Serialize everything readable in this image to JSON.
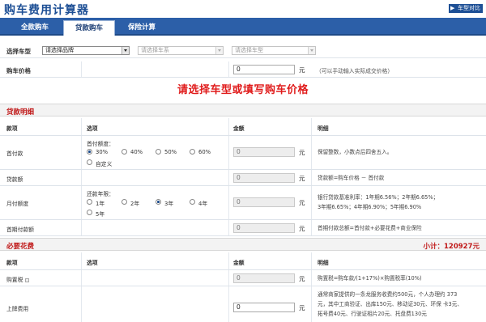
{
  "header": {
    "title": "购车费用计算器",
    "compare_link": "车型对比",
    "compare_arrow": "▶"
  },
  "tabs": [
    {
      "label": "全款购车",
      "active": false
    },
    {
      "label": "贷款购车",
      "active": true
    },
    {
      "label": "保险计算",
      "active": false
    }
  ],
  "car_select": {
    "label": "选择车型",
    "brand_value": "请选择品牌",
    "series_value": "请选择车系",
    "model_value": "请选择车型"
  },
  "price": {
    "label": "购车价格",
    "value": "0",
    "unit": "元",
    "hint": "（可以手动输入实际成交价格）"
  },
  "prompt": "请选择车型或填写购车价格",
  "loan": {
    "section_title": "贷款明细",
    "headers": {
      "item": "款项",
      "option": "选项",
      "amount": "金额",
      "detail": "明细"
    },
    "down_payment": {
      "label": "首付款",
      "ratio_label": "首付额度：",
      "options": [
        "30%",
        "40%",
        "50%",
        "60%",
        "自定义"
      ],
      "selected": "30%",
      "value": "0",
      "unit": "元",
      "detail": "保留整数，小数点后四舍五入。"
    },
    "loan_amount": {
      "label": "贷款额",
      "value": "0",
      "unit": "元",
      "detail": "贷款额=购车价格 － 首付款"
    },
    "monthly": {
      "label": "月付额度",
      "term_label": "还款年限：",
      "options": [
        "1年",
        "2年",
        "3年",
        "4年",
        "5年"
      ],
      "selected": "3年",
      "value": "0",
      "unit": "元",
      "detail_lines": [
        "银行贷款基准利率：1年期6.56%；2年期6.65%；",
        "3年期6.65%；4年期6.90%；5年期6.90%"
      ]
    },
    "first_payment": {
      "label": "首期付款额",
      "value": "0",
      "unit": "元",
      "detail": "首期付款总额=首付款+必要花费+商业保险"
    }
  },
  "expenses": {
    "section_title": "必要花费",
    "subtotal": "小计：120927元",
    "headers": {
      "item": "款项",
      "option": "选项",
      "amount": "金额",
      "detail": "明细"
    },
    "purchase_tax": {
      "label": "购置税",
      "value": "0",
      "unit": "元",
      "detail": "购置税=购车款/(1+17%)×购置税率(10%)"
    },
    "registration": {
      "label": "上牌费用",
      "value": "0",
      "unit": "元",
      "detail_lines": [
        "通常商家提供的一条龙服务收费约500元，个人办理约 373",
        "元，其中工商验证、出库150元、移动证30元、环保 卡3元、",
        "拓号费40元、行驶证相片20元、托盘费130元"
      ]
    }
  }
}
